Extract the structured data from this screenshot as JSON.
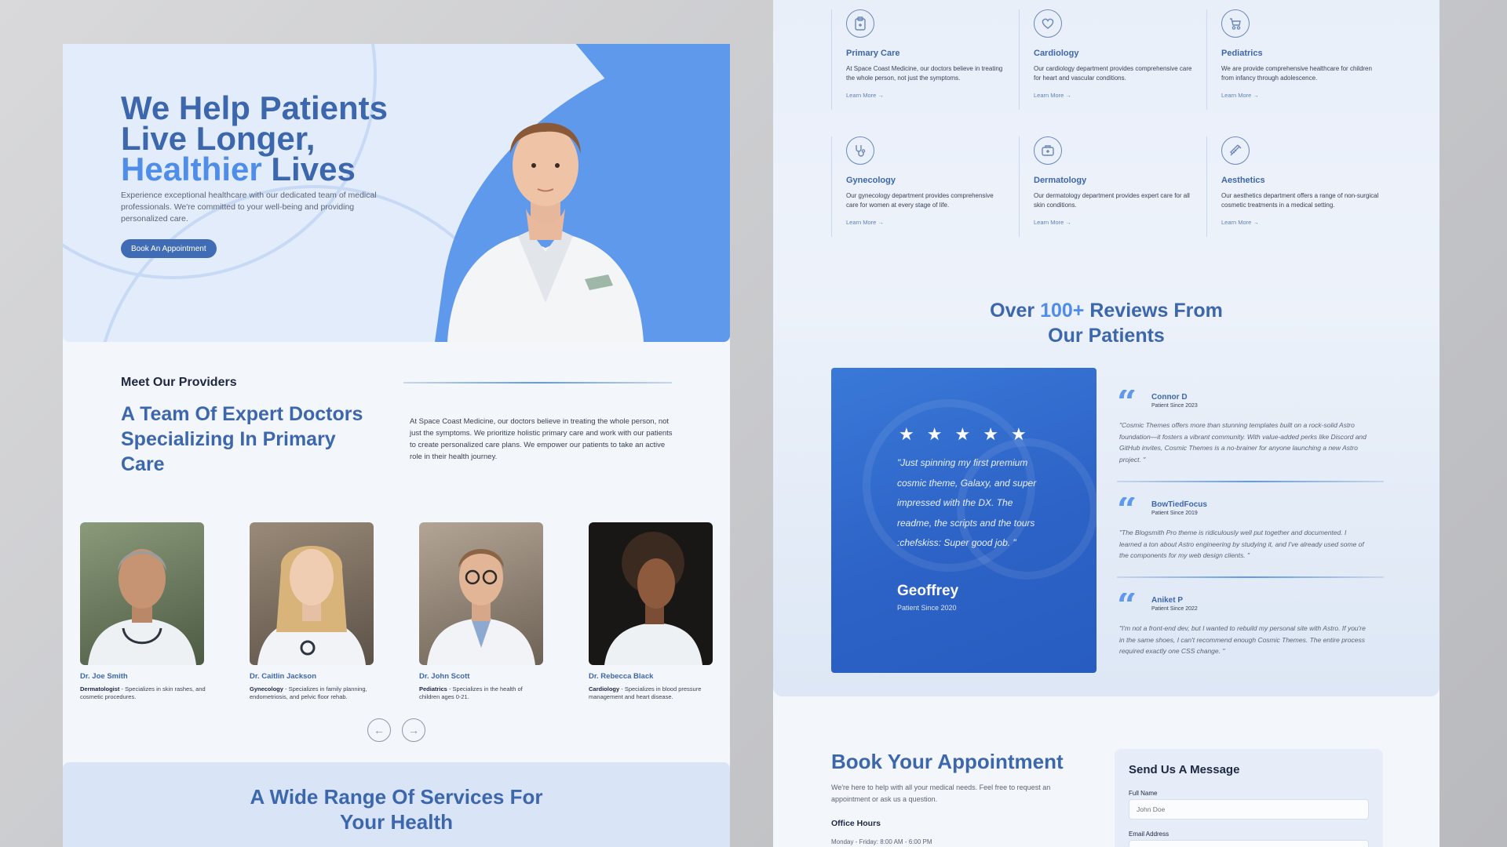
{
  "left": {
    "hero": {
      "title_line1": "We Help Patients",
      "title_line2": "Live Longer,",
      "title_accent": "Healthier",
      "title_end": "Lives",
      "subtitle": "Experience exceptional healthcare with our dedicated team of medical professionals. We're committed to your well-being and providing personalized care.",
      "cta": "Book An Appointment"
    },
    "providers": {
      "kicker": "Meet Our Providers",
      "title": "A Team Of Expert Doctors Specializing In Primary Care",
      "text": "At Space Coast Medicine, our doctors believe in treating the whole person, not just the symptoms. We prioritize holistic primary care and work with our patients to create personalized care plans. We empower our patients to take an active role in their health journey.",
      "doctors": [
        {
          "name": "Dr. Joe Smith",
          "specialty": "Dermatologist",
          "desc": " - Specializes in skin rashes, and cosmetic procedures."
        },
        {
          "name": "Dr. Caitlin Jackson",
          "specialty": "Gynecology",
          "desc": " - Specializes in family planning, endometriosis, and pelvic floor rehab."
        },
        {
          "name": "Dr. John Scott",
          "specialty": "Pediatrics",
          "desc": " - Specializes in the health of children ages 0-21."
        },
        {
          "name": "Dr. Rebecca Black",
          "specialty": "Cardiology",
          "desc": " - Specializes in blood pressure management and heart disease."
        }
      ],
      "prev_icon": "arrow-left-icon",
      "next_icon": "arrow-right-icon"
    },
    "services_band": {
      "title_line1": "A Wide Range Of Services For",
      "title_line2": "Your Health"
    }
  },
  "right": {
    "services": [
      {
        "icon": "clipboard-icon",
        "title": "Primary Care",
        "desc": "At Space Coast Medicine, our doctors believe in treating the whole person, not just the symptoms.",
        "link": "Learn More →"
      },
      {
        "icon": "heart-icon",
        "title": "Cardiology",
        "desc": "Our cardiology department provides comprehensive care for heart and vascular conditions.",
        "link": "Learn More →"
      },
      {
        "icon": "stroller-icon",
        "title": "Pediatrics",
        "desc": "We are provide comprehensive healthcare for children from infancy through adolescence.",
        "link": "Learn More →"
      },
      {
        "icon": "stethoscope-icon",
        "title": "Gynecology",
        "desc": "Our gynecology department provides comprehensive care for women at every stage of life.",
        "link": "Learn More →"
      },
      {
        "icon": "medical-kit-icon",
        "title": "Dermatology",
        "desc": "Our dermatology department provides expert care for all skin conditions.",
        "link": "Learn More →"
      },
      {
        "icon": "syringe-icon",
        "title": "Aesthetics",
        "desc": "Our aesthetics department offers a range of non-surgical cosmetic treatments in a medical setting.",
        "link": "Learn More →"
      }
    ],
    "reviews": {
      "title_pre": "Over ",
      "title_accent": "100+",
      "title_post": " Reviews From",
      "title_line2": "Our Patients",
      "featured": {
        "rating": 5,
        "quote": "\"Just spinning my first premium cosmic theme, Galaxy, and super impressed with the DX. The readme, the scripts and the tours :chefskiss: Super good job. \"",
        "name": "Geoffrey",
        "since": "Patient Since 2020"
      },
      "items": [
        {
          "name": "Connor D",
          "since": "Patient Since 2023",
          "text": "\"Cosmic Themes offers more than stunning templates built on a rock-solid Astro foundation—it fosters a vibrant community. With value-added perks like Discord and GitHub invites, Cosmic Themes is a no-brainer for anyone launching a new Astro project. \""
        },
        {
          "name": "BowTiedFocus",
          "since": "Patient Since 2019",
          "text": "\"The Blogsmith Pro theme is ridiculously well put together and documented. I learned a ton about Astro engineering by studying it, and I've already used some of the components for my web design clients. \""
        },
        {
          "name": "Aniket P",
          "since": "Patient Since 2022",
          "text": "\"I'm not a front-end dev, but I wanted to rebuild my personal site with Astro. If you're in the same shoes, I can't recommend enough Cosmic Themes. The entire process required exactly one CSS change. \""
        }
      ]
    },
    "booking": {
      "title": "Book Your Appointment",
      "text": "We're here to help with all your medical needs. Feel free to request an appointment or ask us a question.",
      "office_title": "Office Hours",
      "office_hours": "Monday - Friday: 8:00 AM - 6:00 PM"
    },
    "message": {
      "title": "Send Us A Message",
      "full_name_label": "Full Name",
      "full_name_placeholder": "John Doe",
      "email_label": "Email Address"
    }
  }
}
